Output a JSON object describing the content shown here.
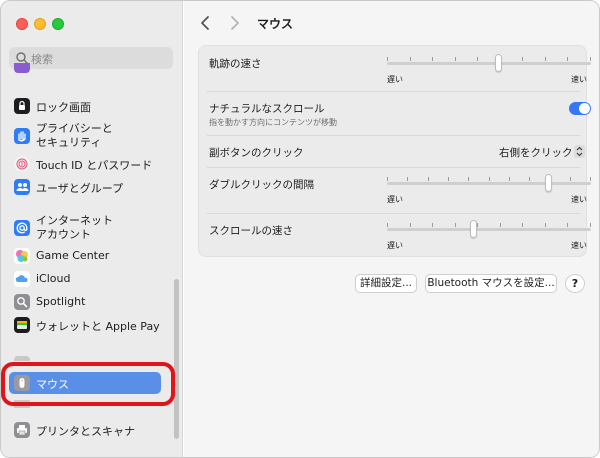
{
  "sidebar": {
    "search_placeholder": "検索",
    "items": [
      {
        "label": "ロック画面",
        "icon": "lock-icon",
        "color": "#1d1d1f"
      },
      {
        "label": "プライバシーと",
        "label2": "セキュリティ",
        "icon": "hand-icon",
        "color": "#2f7df6"
      },
      {
        "label": "Touch ID とパスワード",
        "icon": "fingerprint-icon",
        "color": "#f0f0f0"
      },
      {
        "label": "ユーザとグループ",
        "icon": "users-icon",
        "color": "#2f7df6"
      },
      {
        "label": "インターネット",
        "label2": "アカウント",
        "icon": "at-icon",
        "color": "#2f7df6"
      },
      {
        "label": "Game Center",
        "icon": "game-center-icon",
        "color": "#ffffff"
      },
      {
        "label": "iCloud",
        "icon": "cloud-icon",
        "color": "#ffffff"
      },
      {
        "label": "Spotlight",
        "icon": "magnifier-icon",
        "color": "#8e8e93"
      },
      {
        "label": "ウォレットと Apple Pay",
        "icon": "wallet-icon",
        "color": "#1d1d1f"
      },
      {
        "label": "マウス",
        "icon": "mouse-icon",
        "color": "#8e8e93",
        "selected": true
      },
      {
        "label": "プリンタとスキャナ",
        "icon": "printer-icon",
        "color": "#8e8e93"
      }
    ]
  },
  "header": {
    "title": "マウス"
  },
  "settings": {
    "tracking_speed": {
      "label": "軌跡の速さ",
      "min_label": "遅い",
      "max_label": "速い",
      "value": 0.55
    },
    "natural_scroll": {
      "label": "ナチュラルなスクロール",
      "sublabel": "指を動かす方向にコンテンツが移動",
      "on": true
    },
    "secondary_click": {
      "label": "副ボタンのクリック",
      "value": "右側をクリック"
    },
    "double_click_speed": {
      "label": "ダブルクリックの間隔",
      "min_label": "遅い",
      "max_label": "速い",
      "value": 0.8
    },
    "scroll_speed": {
      "label": "スクロールの速さ",
      "min_label": "遅い",
      "max_label": "速い",
      "value": 0.42
    }
  },
  "buttons": {
    "advanced": "詳細設定...",
    "bluetooth": "Bluetooth マウスを設定...",
    "help": "?"
  },
  "colors": {
    "accent": "#3478f6",
    "selection": "#5a8fe8",
    "highlight_ring": "#e0141b"
  }
}
